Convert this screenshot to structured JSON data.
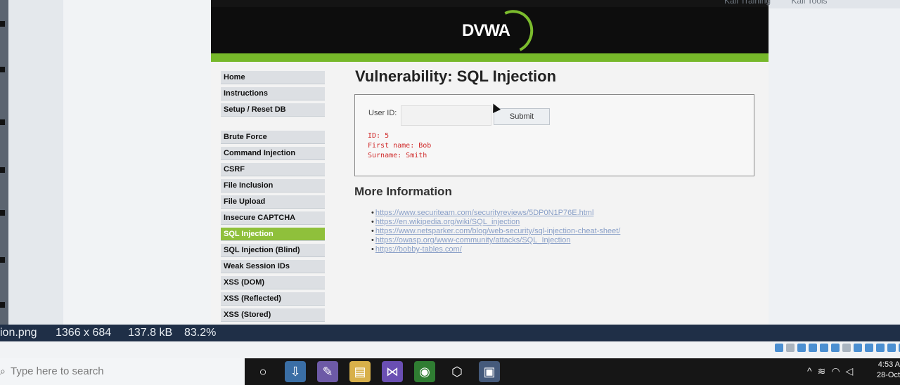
{
  "top_links": {
    "left": [
      "",
      "",
      ""
    ],
    "right": [
      "Kali Training",
      "Kali Tools"
    ]
  },
  "app": {
    "logo_text": "DVWA",
    "page_title": "Vulnerability: SQL Injection",
    "user_id_label": "User ID:",
    "submit_label": "Submit",
    "result_lines": [
      "ID: 5",
      "First name: Bob",
      "Surname: Smith"
    ],
    "more_info_title": "More Information",
    "links": [
      "https://www.securiteam.com/securityreviews/5DP0N1P76E.html",
      "https://en.wikipedia.org/wiki/SQL_injection",
      "https://www.netsparker.com/blog/web-security/sql-injection-cheat-sheet/",
      "https://owasp.org/www-community/attacks/SQL_Injection",
      "https://bobby-tables.com/"
    ]
  },
  "nav": {
    "group1": [
      "Home",
      "Instructions",
      "Setup / Reset DB"
    ],
    "group2": [
      "Brute Force",
      "Command Injection",
      "CSRF",
      "File Inclusion",
      "File Upload",
      "Insecure CAPTCHA",
      "SQL Injection",
      "SQL Injection (Blind)",
      "Weak Session IDs",
      "XSS (DOM)",
      "XSS (Reflected)",
      "XSS (Stored)"
    ],
    "active": "SQL Injection"
  },
  "viewer_status": {
    "filename": "ion.png",
    "dimensions": "1366 x 684",
    "file_size": "137.8 kB",
    "zoom": "83.2%"
  },
  "taskbar": {
    "search_placeholder": "Type here to search",
    "time": "4:53 A",
    "date": "28-Oct"
  },
  "colors": {
    "accent_green": "#8fc03b",
    "result_red": "#d02b2b",
    "taskbar": "#161616"
  }
}
